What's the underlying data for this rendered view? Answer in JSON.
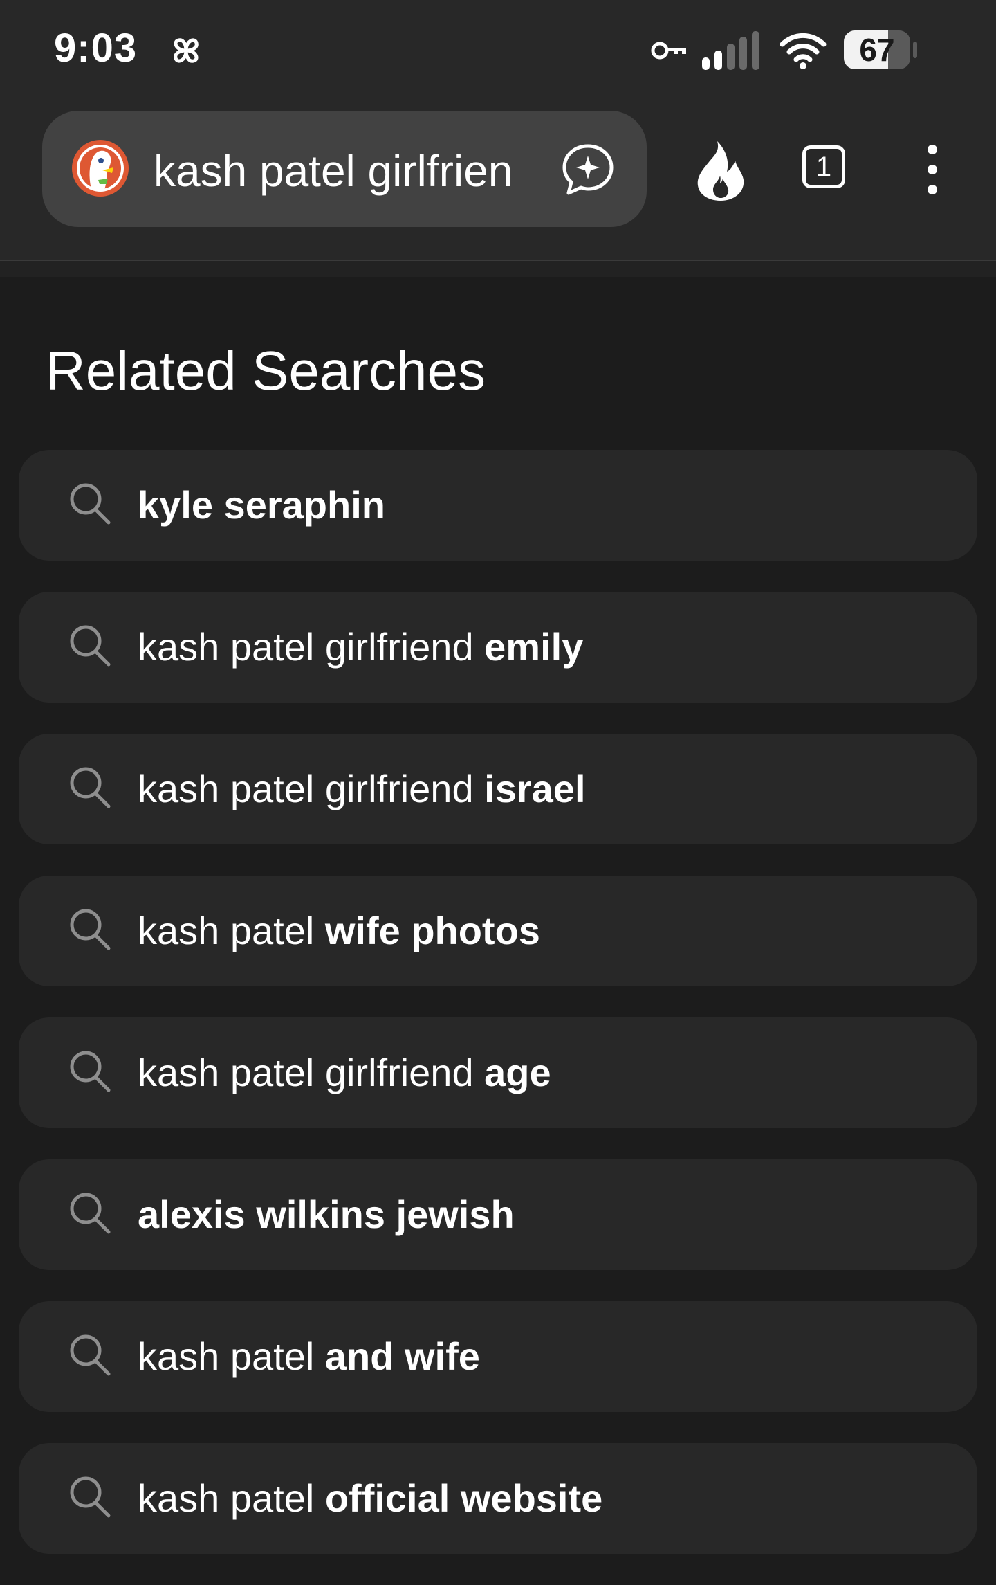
{
  "status_bar": {
    "time": "9:03",
    "battery_level": "67"
  },
  "browser": {
    "query": "kash patel girlfrien",
    "tab_count": "1"
  },
  "related": {
    "title": "Related Searches",
    "items": [
      {
        "prefix": "",
        "bold": "kyle seraphin"
      },
      {
        "prefix": "kash patel girlfriend ",
        "bold": "emily"
      },
      {
        "prefix": "kash patel girlfriend ",
        "bold": "israel"
      },
      {
        "prefix": "kash patel ",
        "bold": "wife photos"
      },
      {
        "prefix": "kash patel girlfriend ",
        "bold": "age"
      },
      {
        "prefix": "",
        "bold": "alexis wilkins jewish"
      },
      {
        "prefix": "kash patel ",
        "bold": "and wife"
      },
      {
        "prefix": "kash patel ",
        "bold": "official website"
      }
    ]
  },
  "icons": {
    "status": [
      "pinwheel-icon",
      "key-icon",
      "signal-icon",
      "wifi-icon",
      "battery-icon"
    ],
    "toolbar": [
      "duckduckgo-logo-icon",
      "ai-chat-icon",
      "fire-icon",
      "tabs-icon",
      "more-menu-icon"
    ],
    "item": "search-icon"
  },
  "colors": {
    "background": "#1c1c1c",
    "toolbar": "#282828",
    "address_bar": "#424242",
    "item_background": "#282828",
    "ddg_orange": "#de5833"
  }
}
